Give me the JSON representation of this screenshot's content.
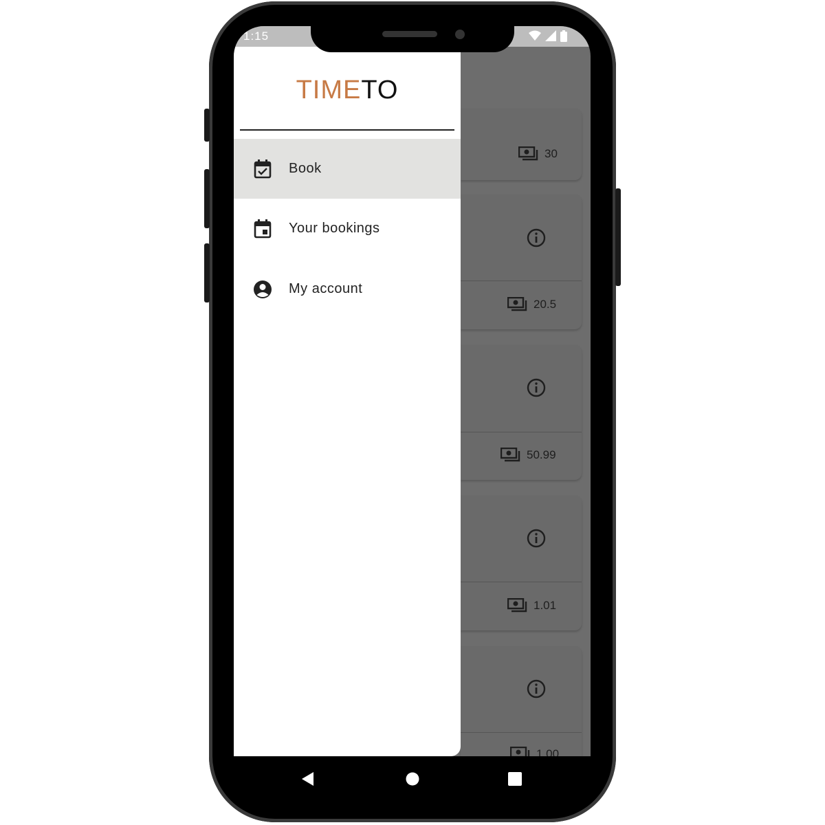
{
  "status_bar": {
    "time": "1:15"
  },
  "drawer": {
    "logo_part1": "TIME",
    "logo_part2": "TO",
    "items": [
      {
        "label": "Book",
        "icon": "calendar-check-icon",
        "active": true
      },
      {
        "label": "Your bookings",
        "icon": "calendar-event-icon",
        "active": false
      },
      {
        "label": "My account",
        "icon": "account-circle-icon",
        "active": false
      }
    ]
  },
  "background_list": {
    "prices": [
      "30",
      "20.5",
      "50.99",
      "1.01",
      "1.00"
    ]
  },
  "colors": {
    "logo_accent": "#c77a45",
    "active_item_bg": "#e2e2e0",
    "scrim": "#6d6d6d"
  }
}
